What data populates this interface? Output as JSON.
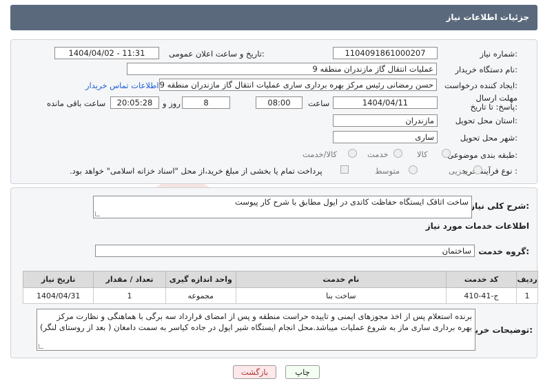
{
  "header": {
    "title": "جزئیات اطلاعات نیاز"
  },
  "form": {
    "need_number": {
      "label": "شماره نیاز:",
      "value": "1104091861000207"
    },
    "announce_datetime": {
      "label": "تاریخ و ساعت اعلان عمومی:",
      "value": "1404/04/02 - 11:31"
    },
    "buyer_org": {
      "label": "نام دستگاه خریدار:",
      "value": "عملیات انتقال گاز مازندران منطقه 9"
    },
    "requester": {
      "label": "ایجاد کننده درخواست:",
      "value": "حسن رمضانی رئیس مرکز بهره برداری ساری عملیات انتقال گاز مازندران منطقه 9",
      "contact_link": "اطلاعات تماس خریدار"
    },
    "deadline": {
      "label": "مهلت ارسال پاسخ: تا تاریخ:",
      "date": "1404/04/11",
      "time_label": "ساعت",
      "time": "08:00",
      "days": "8",
      "days_label": "روز و",
      "remaining": "20:05:28",
      "remaining_label": "ساعت باقی مانده"
    },
    "province": {
      "label": "استان محل تحویل:",
      "value": "مازندران"
    },
    "city": {
      "label": "شهر محل تحویل:",
      "value": "ساری"
    },
    "category": {
      "label": "طبقه بندی موضوعی:",
      "options": [
        "کالا",
        "خدمت",
        "کالا/خدمت"
      ]
    },
    "purchase_type": {
      "label": "نوع فرآیند خرید :",
      "options": [
        "جزیی",
        "متوسط"
      ],
      "note": "پرداخت تمام یا بخشی از مبلغ خرید،از محل \"اسناد خزانه اسلامی\" خواهد بود."
    }
  },
  "need_summary": {
    "label": "شرح کلی نیاز:",
    "value": "ساخت اتاقک ایستگاه حفاظت کاتدی در ایول مطابق با شرح کار پیوست"
  },
  "services": {
    "title": "اطلاعات خدمات مورد نیاز",
    "group_label": "گروه خدمت:",
    "group_value": "ساختمان",
    "columns": [
      "ردیف",
      "کد خدمت",
      "نام خدمت",
      "واحد اندازه گیری",
      "تعداد / مقدار",
      "تاریخ نیاز"
    ],
    "rows": [
      [
        "1",
        "ج-41-410",
        "ساخت بنا",
        "مجموعه",
        "1",
        "1404/04/31"
      ]
    ]
  },
  "buyer_notes": {
    "label": "توضیحات خریدار:",
    "value": "برنده استعلام  پس از اخذ مجوزهای ایمنی و تاییده حراست منطقه و پس از امضای قرارداد سه برگی با هماهنگی و نظارت مرکز بهره برداری ساری ماز به شروع عملیات میباشد.محل انجام ایستگاه شیر ایول در جاده کیاسر به سمت دامغان ( بعد از روستای لنگر)"
  },
  "buttons": {
    "print": "چاپ",
    "back": "بازگشت"
  },
  "colors": {
    "header": "#5a6a7c",
    "panel": "#f5f6f7",
    "link": "#1e5fd8",
    "watermark": "#c0392b"
  },
  "watermark_text": "AriaTender.neT"
}
